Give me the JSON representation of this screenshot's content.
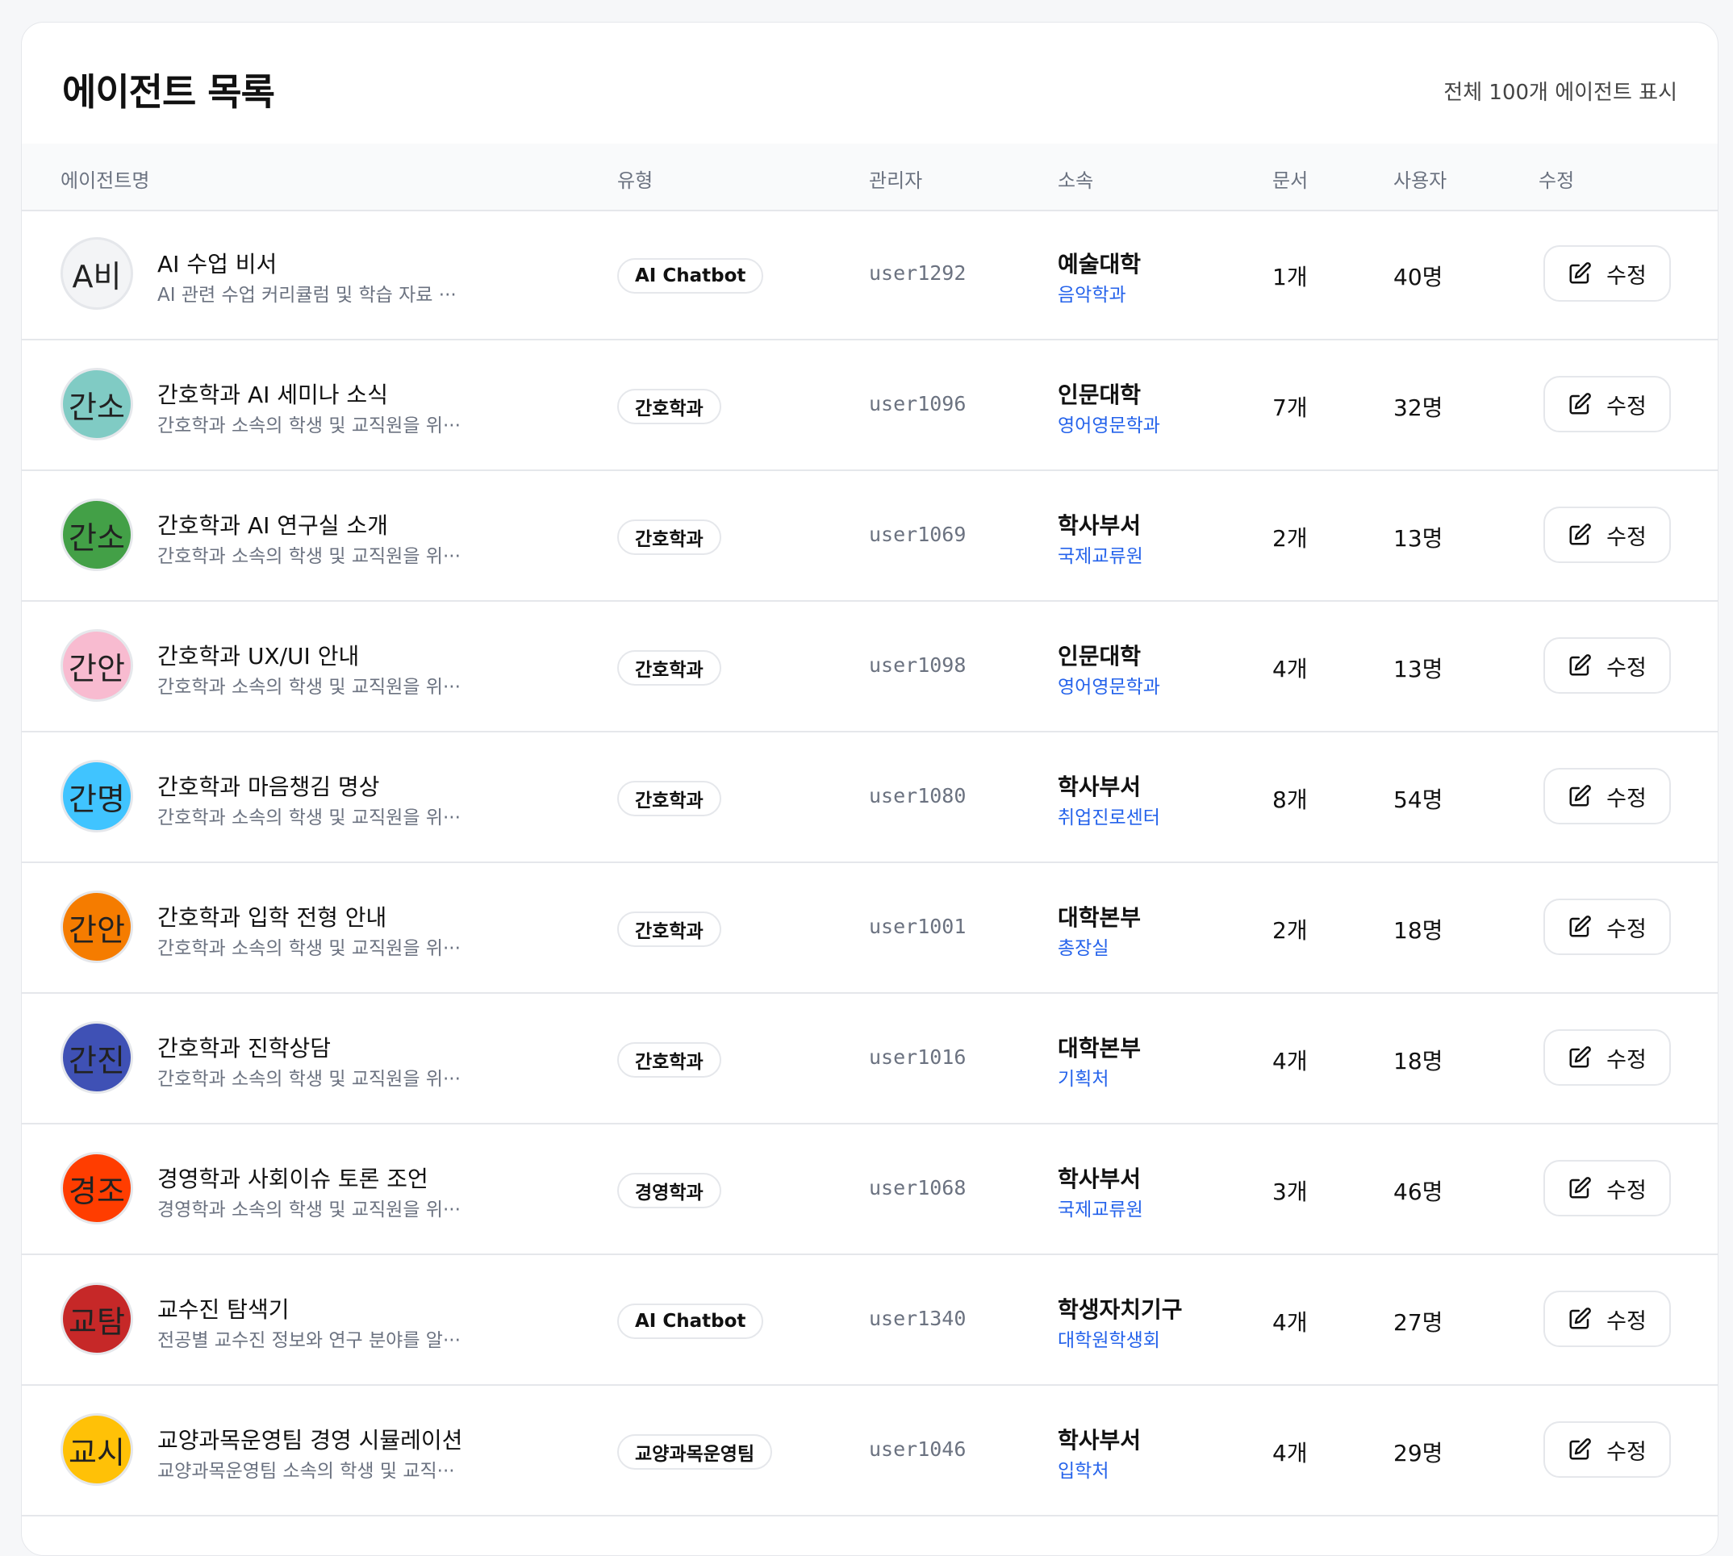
{
  "header": {
    "title": "에이전트 목록",
    "total": "전체 100개 에이전트 표시"
  },
  "columns": {
    "name": "에이전트명",
    "type": "유형",
    "manager": "관리자",
    "org": "소속",
    "docs": "문서",
    "users": "사용자",
    "edit": "수정"
  },
  "rows": [
    {
      "initials": "A비",
      "color": "#f3f4f6",
      "name": "AI 수업 비서",
      "desc": "AI 관련 수업 커리큘럼 및 학습 자료 ···",
      "type": "AI Chatbot",
      "manager": "user1292",
      "org": "예술대학",
      "dept": "음악학과",
      "docs": "1개",
      "users": "40명",
      "edit": "수정"
    },
    {
      "initials": "간소",
      "color": "#80cbc4",
      "name": "간호학과 AI 세미나 소식",
      "desc": "간호학과 소속의 학생 및 교직원을 위···",
      "type": "간호학과",
      "manager": "user1096",
      "org": "인문대학",
      "dept": "영어영문학과",
      "docs": "7개",
      "users": "32명",
      "edit": "수정"
    },
    {
      "initials": "간소",
      "color": "#43a047",
      "name": "간호학과 AI 연구실 소개",
      "desc": "간호학과 소속의 학생 및 교직원을 위···",
      "type": "간호학과",
      "manager": "user1069",
      "org": "학사부서",
      "dept": "국제교류원",
      "docs": "2개",
      "users": "13명",
      "edit": "수정"
    },
    {
      "initials": "간안",
      "color": "#f8bbd0",
      "name": "간호학과 UX/UI 안내",
      "desc": "간호학과 소속의 학생 및 교직원을 위···",
      "type": "간호학과",
      "manager": "user1098",
      "org": "인문대학",
      "dept": "영어영문학과",
      "docs": "4개",
      "users": "13명",
      "edit": "수정"
    },
    {
      "initials": "간명",
      "color": "#40c4ff",
      "name": "간호학과 마음챙김 명상",
      "desc": "간호학과 소속의 학생 및 교직원을 위···",
      "type": "간호학과",
      "manager": "user1080",
      "org": "학사부서",
      "dept": "취업진로센터",
      "docs": "8개",
      "users": "54명",
      "edit": "수정"
    },
    {
      "initials": "간안",
      "color": "#f57c00",
      "name": "간호학과 입학 전형 안내",
      "desc": "간호학과 소속의 학생 및 교직원을 위···",
      "type": "간호학과",
      "manager": "user1001",
      "org": "대학본부",
      "dept": "총장실",
      "docs": "2개",
      "users": "18명",
      "edit": "수정"
    },
    {
      "initials": "간진",
      "color": "#3f51b5",
      "name": "간호학과 진학상담",
      "desc": "간호학과 소속의 학생 및 교직원을 위···",
      "type": "간호학과",
      "manager": "user1016",
      "org": "대학본부",
      "dept": "기획처",
      "docs": "4개",
      "users": "18명",
      "edit": "수정"
    },
    {
      "initials": "경조",
      "color": "#ff3d00",
      "name": "경영학과 사회이슈 토론 조언",
      "desc": "경영학과 소속의 학생 및 교직원을 위···",
      "type": "경영학과",
      "manager": "user1068",
      "org": "학사부서",
      "dept": "국제교류원",
      "docs": "3개",
      "users": "46명",
      "edit": "수정"
    },
    {
      "initials": "교탐",
      "color": "#c62828",
      "name": "교수진 탐색기",
      "desc": "전공별 교수진 정보와 연구 분야를 알···",
      "type": "AI Chatbot",
      "manager": "user1340",
      "org": "학생자치기구",
      "dept": "대학원학생회",
      "docs": "4개",
      "users": "27명",
      "edit": "수정"
    },
    {
      "initials": "교시",
      "color": "#ffc107",
      "name": "교양과목운영팀 경영 시뮬레이션",
      "desc": "교양과목운영팀 소속의 학생 및 교직···",
      "type": "교양과목운영팀",
      "manager": "user1046",
      "org": "학사부서",
      "dept": "입학처",
      "docs": "4개",
      "users": "29명",
      "edit": "수정"
    }
  ]
}
